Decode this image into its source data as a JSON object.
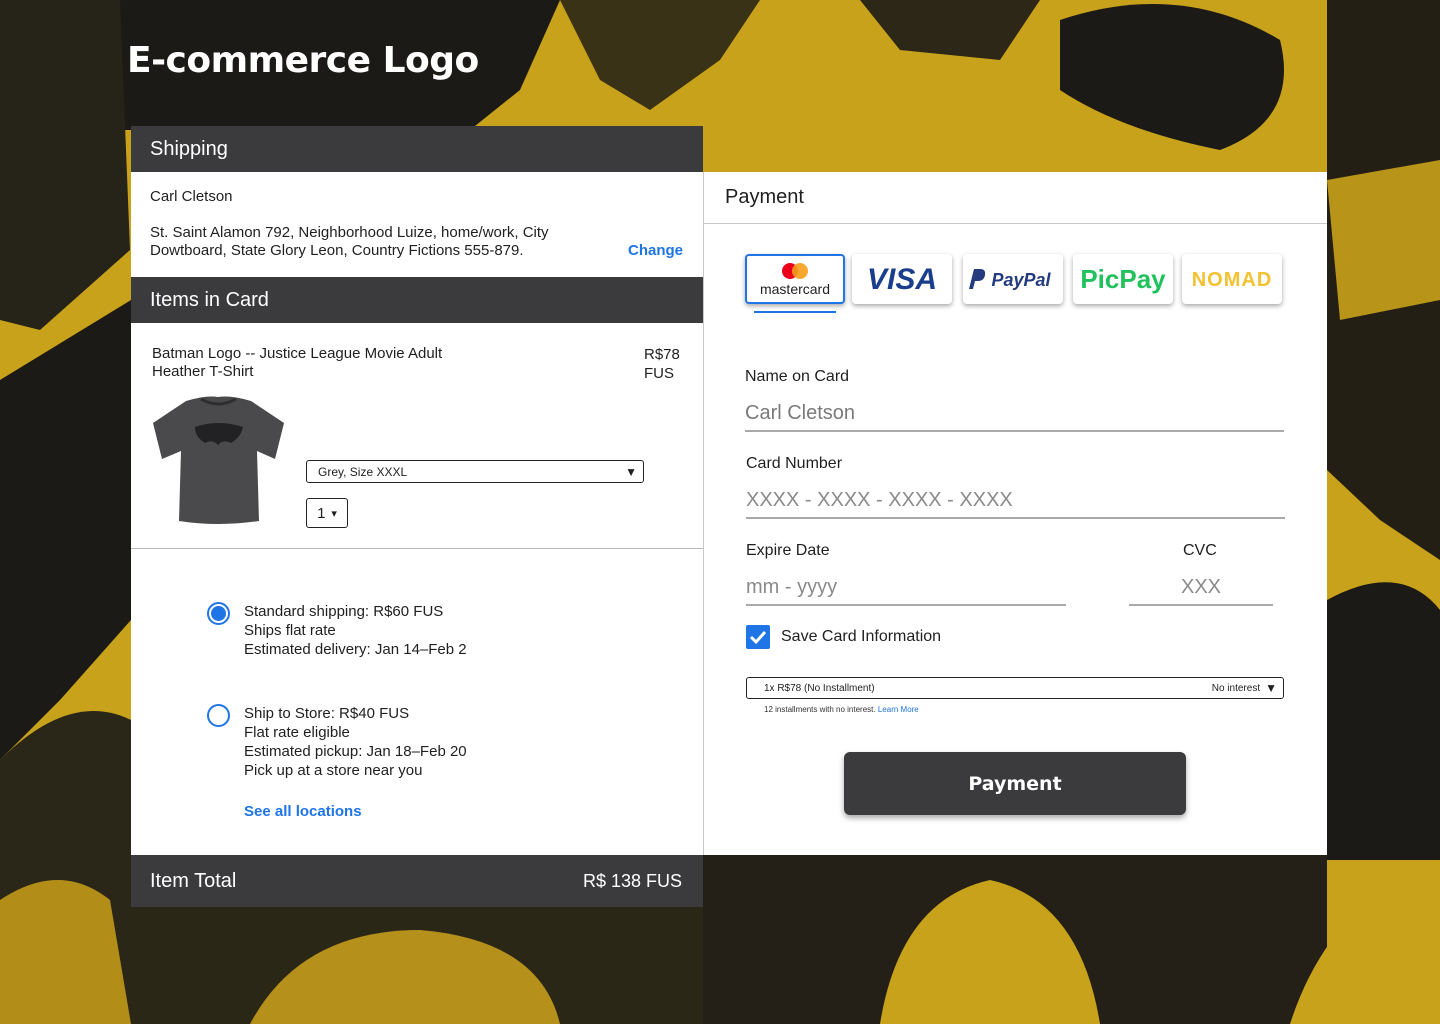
{
  "brand": {
    "logo_text": "E-commerce Logo"
  },
  "shipping": {
    "title": "Shipping",
    "name": "Carl Cletson",
    "address": "St. Saint Alamon 792, Neighborhood Luize,  home/work, City Dowtboard, State Glory Leon, Country Fictions 555-879.",
    "change_label": "Change"
  },
  "items": {
    "title": "Items in Card",
    "product_name": "Batman Logo -- Justice League Movie Adult Heather T-Shirt",
    "price": "R$78 FUS",
    "variant": "Grey, Size XXXL",
    "quantity": "1"
  },
  "shipping_options": [
    {
      "title": "Standard shipping: R$60 FUS",
      "lines": [
        "Ships flat rate",
        "Estimated delivery: Jan 14–Feb 2"
      ],
      "selected": true
    },
    {
      "title": "Ship to Store: R$40 FUS",
      "lines": [
        "Flat rate eligible",
        "Estimated pickup: Jan 18–Feb 20",
        "Pick up at a store near you"
      ],
      "selected": false
    }
  ],
  "see_all_locations": "See all locations",
  "total": {
    "label": "Item Total",
    "value": "R$ 138 FUS"
  },
  "payment": {
    "title": "Payment",
    "methods": [
      {
        "name": "mastercard",
        "label": "mastercard",
        "selected": true
      },
      {
        "name": "visa",
        "label": "VISA",
        "selected": false
      },
      {
        "name": "paypal",
        "label": "PayPal",
        "selected": false
      },
      {
        "name": "picpay",
        "label": "PicPay",
        "selected": false
      },
      {
        "name": "nomad",
        "label": "NOMAD",
        "selected": false
      }
    ],
    "name_label": "Name on Card",
    "name_value": "Carl Cletson",
    "card_label": "Card Number",
    "card_placeholder": "XXXX - XXXX - XXXX - XXXX",
    "expire_label": "Expire Date",
    "expire_placeholder": "mm - yyyy",
    "cvc_label": "CVC",
    "cvc_placeholder": "XXX",
    "save_card_label": "Save Card Information",
    "save_card_checked": true,
    "installment_selected": "1x R$78 (No Installment)",
    "installment_tag": "No interest",
    "installment_note": "12 installments with no interest.",
    "learn_more": "Learn More",
    "pay_button": "Payment"
  },
  "colors": {
    "accent": "#1f74e6",
    "dark_bar": "#3b3b3d",
    "background_yellow": "#c9a21b",
    "background_dark": "#1b1a16"
  }
}
